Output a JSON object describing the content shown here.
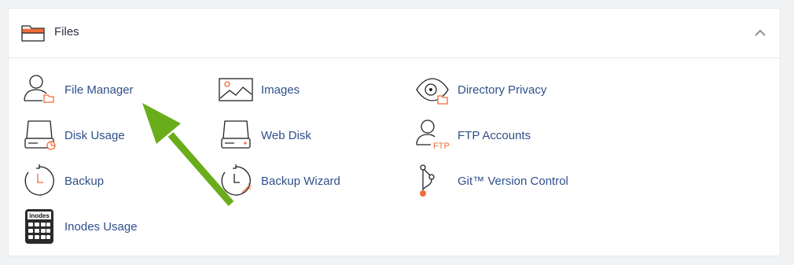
{
  "section": {
    "title": "Files",
    "icon": "folder-icon",
    "collapse_icon": "chevron-up-icon",
    "accent_color": "#f26c38",
    "link_color": "#2f4f8a"
  },
  "items": [
    {
      "label": "File Manager",
      "icon": "file-manager-icon"
    },
    {
      "label": "Images",
      "icon": "images-icon"
    },
    {
      "label": "Directory Privacy",
      "icon": "directory-privacy-icon"
    },
    {
      "label": "Disk Usage",
      "icon": "disk-usage-icon"
    },
    {
      "label": "Web Disk",
      "icon": "web-disk-icon"
    },
    {
      "label": "FTP Accounts",
      "icon": "ftp-accounts-icon",
      "icon_text": "FTP"
    },
    {
      "label": "Backup",
      "icon": "backup-icon"
    },
    {
      "label": "Backup Wizard",
      "icon": "backup-wizard-icon"
    },
    {
      "label": "Git™ Version Control",
      "icon": "git-icon"
    },
    {
      "label": "Inodes Usage",
      "icon": "inodes-usage-icon",
      "icon_text": "inodes"
    }
  ],
  "annotation": {
    "arrow_color": "#6aad1b",
    "arrow_icon": "green-arrow-icon"
  }
}
